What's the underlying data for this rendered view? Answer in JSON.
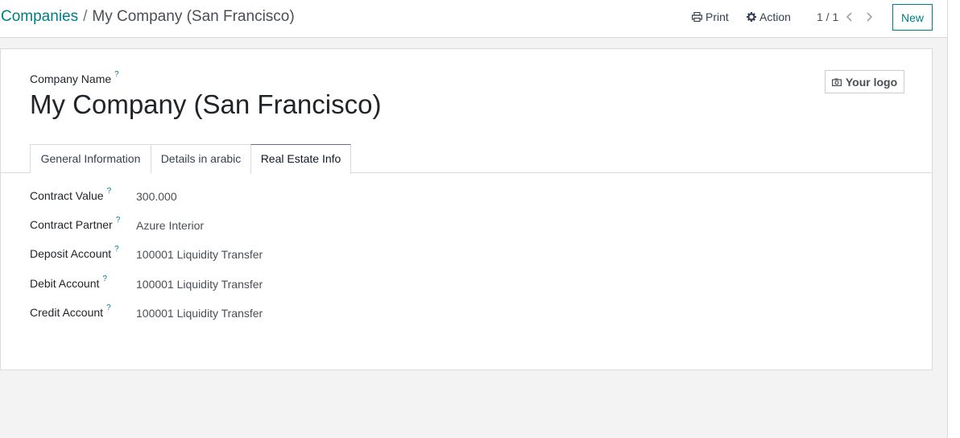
{
  "breadcrumb": {
    "parent": "Companies",
    "separator": "/",
    "current": "My Company (San Francisco)"
  },
  "toolbar": {
    "print_label": "Print",
    "action_label": "Action",
    "pager_value": "1 / 1",
    "new_label": "New"
  },
  "form": {
    "company_name_label": "Company Name",
    "help_mark": "?",
    "company_name": "My Company (San Francisco)",
    "logo_label": "Your logo",
    "tabs": [
      {
        "label": "General Information"
      },
      {
        "label": "Details in arabic"
      },
      {
        "label": "Real Estate Info"
      }
    ],
    "fields": [
      {
        "label": "Contract Value",
        "value": "300.000"
      },
      {
        "label": "Contract Partner",
        "value": "Azure Interior"
      },
      {
        "label": "Deposit Account",
        "value": "100001 Liquidity Transfer"
      },
      {
        "label": "Debit Account",
        "value": "100001 Liquidity Transfer"
      },
      {
        "label": "Credit Account",
        "value": "100001 Liquidity Transfer"
      }
    ]
  },
  "icons": [
    "printer-icon",
    "gear-icon",
    "chevron-left-icon",
    "chevron-right-icon",
    "camera-icon"
  ],
  "colors": {
    "accent": "#017e84",
    "active_tab_border": "#71639e"
  }
}
